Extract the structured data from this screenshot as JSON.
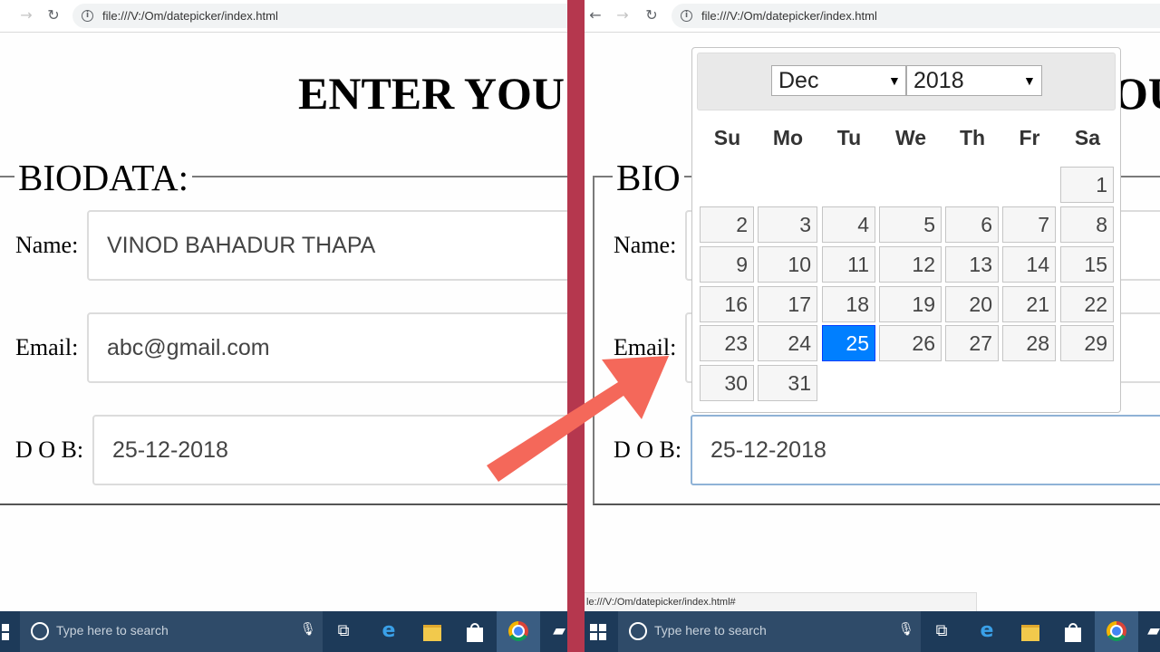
{
  "browser": {
    "url_left": "file:///V:/Om/datepicker/index.html",
    "url_right": "file:///V:/Om/datepicker/index.html",
    "status_url": "le:///V:/Om/datepicker/index.html#"
  },
  "page": {
    "heading_left": "ENTER YOU",
    "heading_right_fragment": "OU",
    "legend_left": "BIODATA:",
    "legend_right": "BIO"
  },
  "form": {
    "name_label": "Name:",
    "name_value": "VINOD BAHADUR THAPA",
    "email_label": "Email:",
    "email_value": "abc@gmail.com",
    "dob_label": "D O B:",
    "dob_value": "25-12-2018"
  },
  "datepicker": {
    "month_selected": "Dec",
    "year_selected": "2018",
    "weekdays": [
      "Su",
      "Mo",
      "Tu",
      "We",
      "Th",
      "Fr",
      "Sa"
    ],
    "days": [
      "1",
      "2",
      "3",
      "4",
      "5",
      "6",
      "7",
      "8",
      "9",
      "10",
      "11",
      "12",
      "13",
      "14",
      "15",
      "16",
      "17",
      "18",
      "19",
      "20",
      "21",
      "22",
      "23",
      "24",
      "25",
      "26",
      "27",
      "28",
      "29",
      "30",
      "31"
    ],
    "selected_day": "25",
    "first_weekday_index": 6
  },
  "taskbar": {
    "search_placeholder": "Type here to search",
    "icons": [
      "windows-start-icon",
      "task-view-icon",
      "edge-icon",
      "file-explorer-icon",
      "store-icon",
      "chrome-icon",
      "tray-icon"
    ]
  },
  "colors": {
    "divider": "#b5374e",
    "arrow": "#f4685a",
    "selected_day": "#007fff",
    "taskbar": "#1d3a59"
  }
}
